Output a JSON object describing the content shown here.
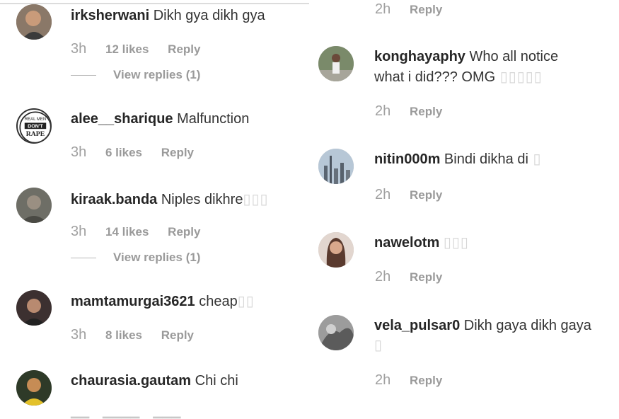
{
  "left_comments": [
    {
      "username": "irksherwani",
      "text": "Dikh gya dikh gya",
      "time": "3h",
      "likes": "12 likes",
      "reply": "Reply",
      "view_replies": "View replies (1)",
      "avatar_icon": "profile-photo-icon"
    },
    {
      "username": "alee__sharique",
      "text": "Malfunction",
      "time": "3h",
      "likes": "6 likes",
      "reply": "Reply",
      "avatar_icon": "logo-badge-icon",
      "avatar_logo_text": [
        "REAL MEN",
        "DON'T",
        "RAPE"
      ]
    },
    {
      "username": "kiraak.banda",
      "text": "Niples dikhre",
      "time": "3h",
      "likes": "14 likes",
      "reply": "Reply",
      "view_replies": "View replies (1)",
      "avatar_icon": "profile-photo-icon"
    },
    {
      "username": "mamtamurgai3621",
      "text": "cheap",
      "time": "3h",
      "likes": "8 likes",
      "reply": "Reply",
      "avatar_icon": "profile-photo-icon"
    },
    {
      "username": "chaurasia.gautam",
      "text": "Chi chi",
      "avatar_icon": "profile-photo-icon"
    }
  ],
  "right_comments": [
    {
      "time": "2h",
      "reply": "Reply"
    },
    {
      "username": "konghayaphy",
      "text": "Who all notice",
      "text_line2": "what i did??? OMG",
      "time": "2h",
      "reply": "Reply",
      "avatar_icon": "profile-photo-icon"
    },
    {
      "username": "nitin000m",
      "text": "Bindi dikha di",
      "time": "2h",
      "reply": "Reply",
      "avatar_icon": "city-photo-icon"
    },
    {
      "username": "nawelotm",
      "text": "",
      "time": "2h",
      "reply": "Reply",
      "avatar_icon": "profile-photo-icon"
    },
    {
      "username": "vela_pulsar0",
      "text": "Dikh gaya dikh gaya",
      "time": "2h",
      "reply": "Reply",
      "avatar_icon": "profile-photo-icon"
    }
  ],
  "colors": {
    "text": "#262626",
    "meta": "#9a9a9a",
    "background": "#ffffff"
  }
}
